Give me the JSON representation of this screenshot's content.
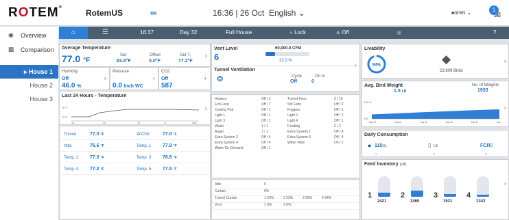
{
  "header": {
    "logo_left": "R",
    "logo_o": "O",
    "logo_right": "TEM",
    "logo_mark": "®",
    "farm": "RotemUS",
    "time": "16:36",
    "date": "26 Oct",
    "language": "English ⌄",
    "user": "oren ⌄",
    "notifications": "1"
  },
  "sidebar": {
    "overview": "Overview",
    "comparison": "Comparison",
    "houses": [
      "▸ House 1",
      "House 2",
      "House 3"
    ]
  },
  "navbar": {
    "time": "16:37",
    "day": "Day 32",
    "mode": "Full House",
    "lock": "Lock",
    "off": "Off",
    "help": "?"
  },
  "avg_temp": {
    "title": "Average Temperature",
    "value": "77.0",
    "unit": "°F",
    "set_label": "Set",
    "set_value": "83.8",
    "set_unit": "°F",
    "offset_label": "Offset",
    "offset_value": "0.0",
    "offset_unit": "°F",
    "out_label": "Out T.",
    "out_value": "77.2",
    "out_unit": "°F"
  },
  "humidity": {
    "label": "Humidity",
    "status": "Off",
    "value": "46.0",
    "unit": "%"
  },
  "pressure": {
    "label": "Pressure",
    "value": "0.0",
    "unit": "Inch WC"
  },
  "co2": {
    "label": "CO2",
    "status": "Off",
    "value": "587"
  },
  "last24": {
    "title": "Last 24 Hours - Temperature",
    "y_ticks": [
      "70 °F",
      "75 °F"
    ],
    "x_ticks": [
      "16",
      "20",
      "12",
      "8",
      "now"
    ]
  },
  "sensors": [
    {
      "name": "Tunnel",
      "value": "77.0",
      "unit": "°F",
      "name2": "W.Chill",
      "value2": "77.0",
      "unit2": "°F"
    },
    {
      "name": "Attic",
      "value": "76.6",
      "unit": "°F",
      "name2": "Temp. 1",
      "value2": "77.9",
      "unit2": "°F"
    },
    {
      "name": "Temp. 2",
      "value": "77.0",
      "unit": "°F",
      "name2": "Temp. 3",
      "value2": "76.6",
      "unit2": "°F"
    },
    {
      "name": "Temp. 4",
      "value": "77.2",
      "unit": "°F",
      "name2": "Temp. 5",
      "value2": "77.5",
      "unit2": "°F"
    }
  ],
  "vent": {
    "title": "Vent Level",
    "value": "6",
    "cfm": "60,000.0 CFM",
    "percent": "22.0 %",
    "level_fraction": 0.22,
    "tunnel_title": "Tunnel Ventilation",
    "cycle_label": "Cycle",
    "cycle_value": "Off",
    "onin_label": "On In",
    "onin_value": "0"
  },
  "devices": [
    [
      "Heaters",
      "Off / 2",
      "Tunnel Fans",
      "3 / 10"
    ],
    [
      "Exh Fans",
      "Off / 7",
      "Stir Fans",
      "Off / 2"
    ],
    [
      "Cooling Pad",
      "Off / 1",
      "Foggers",
      "Off / 1"
    ],
    [
      "Light 1",
      "Off / 1",
      "Light 2",
      "Off / 1"
    ],
    [
      "Light 3",
      "Off / 1",
      "Light 4",
      "Off / 1"
    ],
    [
      "Water",
      "1 / 1",
      "Feeding",
      "2 / 2"
    ],
    [
      "Auger",
      "1 / 1",
      "Extra System 1",
      "Off / 4"
    ],
    [
      "Extra System 2",
      "Off / 4",
      "Extra System 3",
      "Off / 4"
    ],
    [
      "Extra System 4",
      "Off / 4",
      "Water Main",
      "On / 1"
    ],
    [
      "Water On Demand",
      "Off / 1",
      "",
      ""
    ]
  ],
  "inlets": [
    {
      "name": "Attic",
      "vals": [
        "0"
      ]
    },
    {
      "name": "Curtain",
      "vals": [
        "0%"
      ]
    },
    {
      "name": "Tunnel Curtain",
      "vals": [
        "1 60%",
        "2 23%",
        "3 36%",
        "4 34%"
      ]
    },
    {
      "name": "Vent",
      "vals": [
        "1 0%",
        "2 0%"
      ]
    }
  ],
  "livability": {
    "title": "Livability",
    "percent": "94%",
    "fraction": 0.94,
    "birds": "22,609 Birds"
  },
  "weight": {
    "title": "Avg. Bird Weight",
    "value": "1.5",
    "unit": "LB",
    "weights_label": "No. of Weights",
    "weights_value": "1933",
    "y_ticks": [
      "3.00 LB",
      "0.00"
    ],
    "x_ticks": [
      "Day 22",
      "Day 24",
      "Day 26",
      "Day 28",
      "Day 30",
      "Day 32"
    ]
  },
  "chart_data": {
    "type": "area",
    "x": [
      "Day 22",
      "Day 24",
      "Day 26",
      "Day 28",
      "Day 30",
      "Day 32"
    ],
    "series": [
      {
        "values": [
          0.7,
          0.87,
          1.05,
          1.2,
          1.36,
          1.5
        ]
      }
    ],
    "ylim": [
      0,
      3
    ]
  },
  "daily": {
    "title": "Daily Consumption",
    "water_value": "115",
    "water_unit": "GL",
    "feed_unit": "LB",
    "fcr_label": "FCR",
    "fcr_value": "0"
  },
  "feed": {
    "title": "Feed Inventory",
    "unit": "(LB)",
    "bins": [
      {
        "num": "1",
        "value": "2421",
        "fill": 0.24
      },
      {
        "num": "2",
        "value": "3460",
        "fill": 0.35
      },
      {
        "num": "3",
        "value": "1521",
        "fill": 0.15
      },
      {
        "num": "4",
        "value": "1343",
        "fill": 0.13
      }
    ]
  },
  "colors": {
    "accent": "#2f7fd6",
    "nav": "#4b5d70",
    "text_blue": "#1a6fc4"
  }
}
